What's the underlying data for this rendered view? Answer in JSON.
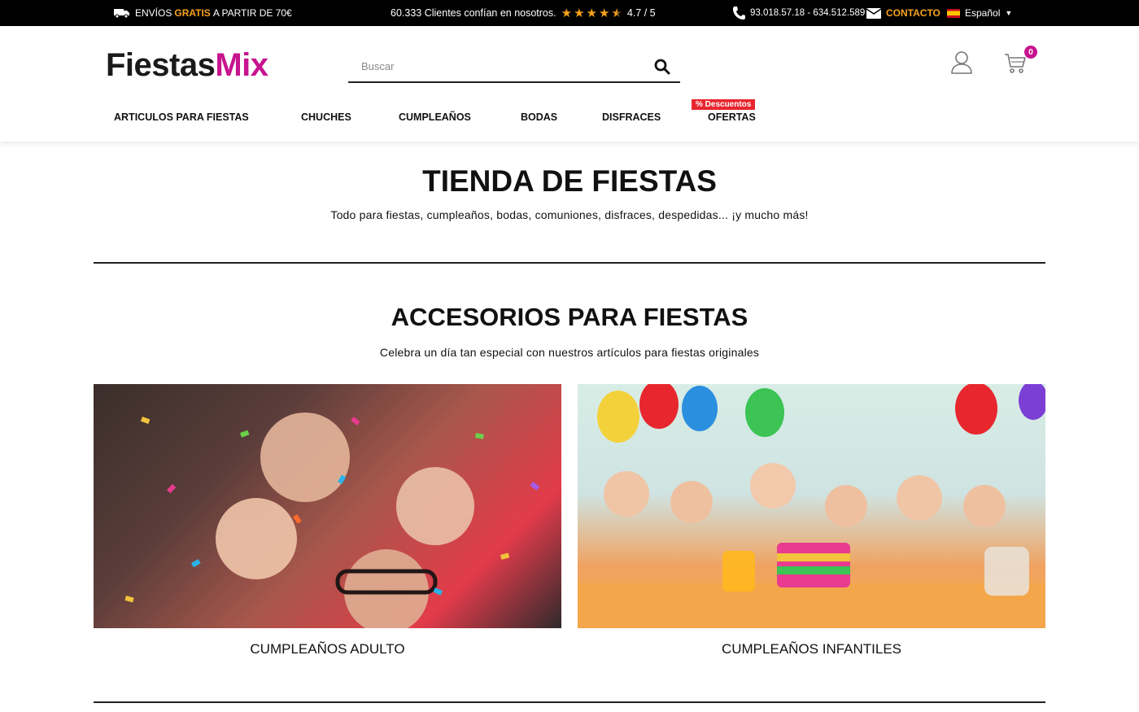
{
  "topbar": {
    "shipping_pre": "ENVÍOS",
    "shipping_highlight": "GRATIS",
    "shipping_post": "A PARTIR DE 70€",
    "clients_text": "60.333 Clientes confían en nosotros.",
    "rating": "4.7 / 5",
    "phones": "93.018.57.18 - 634.512.589",
    "contact_label": "CONTACTO",
    "language": "Español"
  },
  "header": {
    "logo_part1": "Fiestas",
    "logo_part2": "Mix",
    "search_placeholder": "Buscar",
    "cart_count": "0"
  },
  "nav": {
    "items": [
      "ARTICULOS PARA FIESTAS",
      "CHUCHES",
      "CUMPLEAÑOS",
      "BODAS",
      "DISFRACES",
      "OFERTAS"
    ],
    "promo_badge": "% Descuentos"
  },
  "main": {
    "title": "TIENDA DE FIESTAS",
    "subtitle": "Todo para fiestas, cumpleaños, bodas, comuniones, disfraces, despedidas... ¡y mucho más!",
    "section_title": "ACCESORIOS PARA FIESTAS",
    "section_subtitle": "Celebra un día tan especial con nuestros artículos para fiestas originales",
    "cards": [
      {
        "caption": "CUMPLEAÑOS ADULTO"
      },
      {
        "caption": "CUMPLEAÑOS INFANTILES"
      }
    ]
  },
  "colors": {
    "accent_orange": "#f7a21b",
    "brand_magenta": "#c7148f",
    "promo_red": "#e8262e"
  }
}
